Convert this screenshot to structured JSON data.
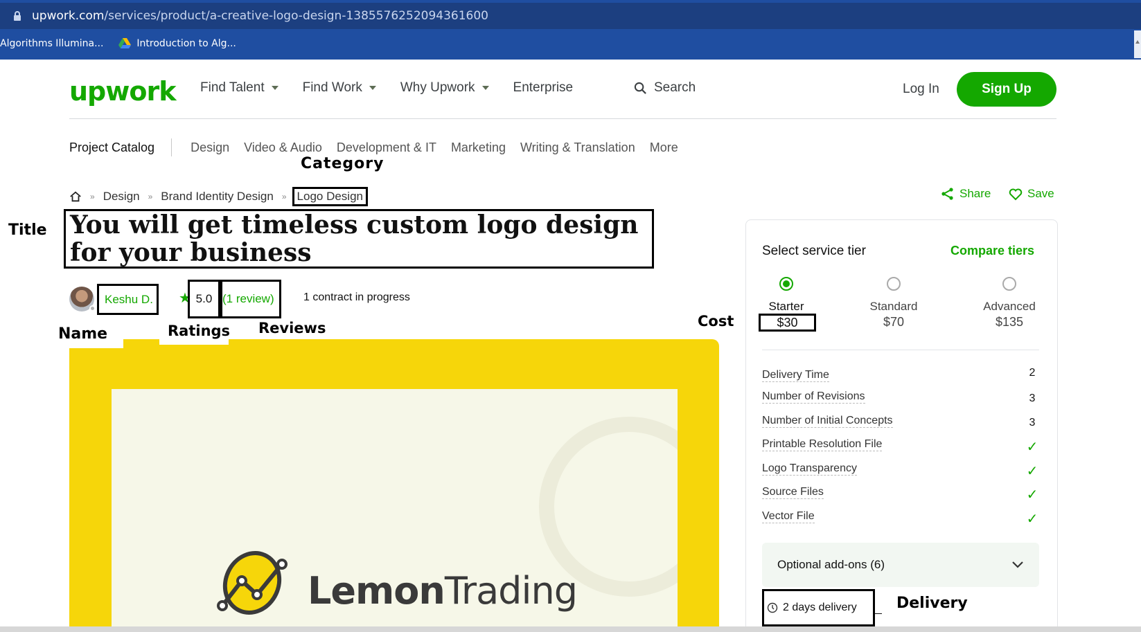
{
  "browser": {
    "url_domain": "upwork.com",
    "url_path": "/services/product/a-creative-logo-design-1385576252094361600",
    "bookmarks": [
      {
        "label": "Algorithms Illumina...",
        "icon": "none"
      },
      {
        "label": "Introduction to Alg...",
        "icon": "google-drive-icon"
      }
    ]
  },
  "header": {
    "logo": "upwork",
    "nav": [
      {
        "label": "Find Talent",
        "has_caret": true
      },
      {
        "label": "Find Work",
        "has_caret": true
      },
      {
        "label": "Why Upwork",
        "has_caret": true
      },
      {
        "label": "Enterprise",
        "has_caret": false
      }
    ],
    "search_label": "Search",
    "login_label": "Log In",
    "signup_label": "Sign Up"
  },
  "catalog": {
    "project_catalog": "Project Catalog",
    "categories": [
      "Design",
      "Video & Audio",
      "Development & IT",
      "Marketing",
      "Writing & Translation",
      "More"
    ]
  },
  "breadcrumb": {
    "items": [
      "Design",
      "Brand Identity Design",
      "Logo Design"
    ]
  },
  "actions": {
    "share": "Share",
    "save": "Save"
  },
  "gig": {
    "title": "You will get timeless custom logo design for your business",
    "seller_name": "Keshu D.",
    "rating": "5.0",
    "reviews": "(1 review)",
    "contracts": "1 contract in progress",
    "gallery_brand_bold": "Lemon",
    "gallery_brand_light": "Trading"
  },
  "annotations": {
    "category": "Category",
    "title": "Title",
    "name": "Name",
    "ratings": "Ratings",
    "reviews": "Reviews",
    "cost": "Cost",
    "delivery": "Delivery"
  },
  "pricing": {
    "heading": "Select service tier",
    "compare": "Compare tiers",
    "tiers": [
      {
        "name": "Starter",
        "price": "$30",
        "selected": true
      },
      {
        "name": "Standard",
        "price": "$70",
        "selected": false
      },
      {
        "name": "Advanced",
        "price": "$135",
        "selected": false
      }
    ],
    "features": [
      {
        "label": "Delivery Time",
        "value": "2"
      },
      {
        "label": "Number of Revisions",
        "value": "3"
      },
      {
        "label": "Number of Initial Concepts",
        "value": "3"
      },
      {
        "label": "Printable Resolution File",
        "value": "✓"
      },
      {
        "label": "Logo Transparency",
        "value": "✓"
      },
      {
        "label": "Source Files",
        "value": "✓"
      },
      {
        "label": "Vector File",
        "value": "✓"
      }
    ],
    "addons": "Optional add-ons (6)",
    "delivery": "2 days delivery"
  },
  "colors": {
    "brand_green": "#14a800",
    "browser_blue": "#1f4ea1",
    "gallery_yellow": "#f6d60a"
  }
}
